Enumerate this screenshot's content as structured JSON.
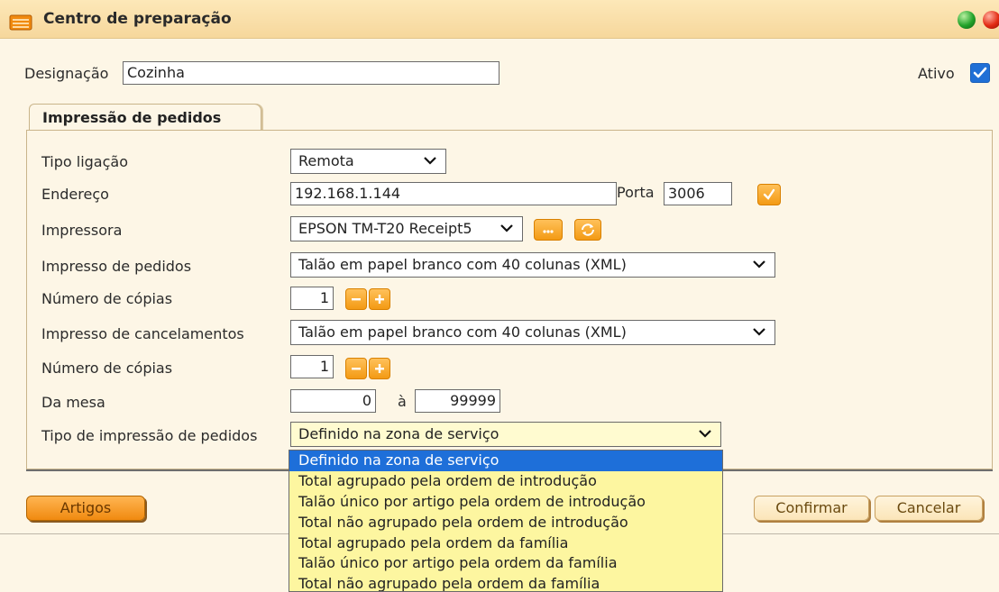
{
  "window": {
    "title": "Centro de preparação"
  },
  "form": {
    "designation_label": "Designação",
    "designation_value": "Cozinha",
    "active_label": "Ativo",
    "active_checked": true,
    "tab_label": "Impressão de pedidos",
    "connection_type_label": "Tipo ligação",
    "connection_type_value": "Remota",
    "address_label": "Endereço",
    "address_value": "192.168.1.144",
    "port_label": "Porta",
    "port_value": "3006",
    "printer_label": "Impressora",
    "printer_value": "EPSON TM-T20 Receipt5",
    "order_print_label": "Impresso de pedidos",
    "order_print_value": "Talão em papel branco com 40 colunas (XML)",
    "copies_label": "Número de cópias",
    "copies_value": "1",
    "cancel_print_label": "Impresso de cancelamentos",
    "cancel_print_value": "Talão em papel branco com 40 colunas (XML)",
    "copies2_label": "Número de cópias",
    "copies2_value": "1",
    "table_range_label": "Da mesa",
    "table_from": "0",
    "table_to_label": "à",
    "table_to": "99999",
    "order_print_type_label": "Tipo de impressão de pedidos",
    "order_print_type_value": "Definido na zona de serviço"
  },
  "dropdown": {
    "options": [
      "Definido na zona de serviço",
      "Total agrupado pela ordem de introdução",
      "Talão único por artigo pela ordem de introdução",
      "Total não agrupado pela ordem de introdução",
      "Total agrupado pela ordem da família",
      "Talão único por artigo pela ordem da família",
      "Total não agrupado pela ordem da família"
    ],
    "selected_index": 0
  },
  "buttons": {
    "articles": "Artigos",
    "confirm": "Confirmar",
    "cancel": "Cancelar"
  },
  "icons": {
    "title": "printer-folder-icon",
    "close_controls": [
      "green-ball-icon",
      "red-ball-icon"
    ],
    "test_connection": "check-icon",
    "printer_browse": "ellipsis-icon",
    "printer_refresh": "refresh-icon",
    "copies_decrement": "minus-icon",
    "copies_increment": "plus-icon"
  },
  "colors": {
    "background": "#fdf6e6",
    "title_bar": "#f6d79c",
    "accent_orange": "#f39a14",
    "selection_blue": "#1e6fd9",
    "dropdown_yellow": "#fdf6a0"
  }
}
